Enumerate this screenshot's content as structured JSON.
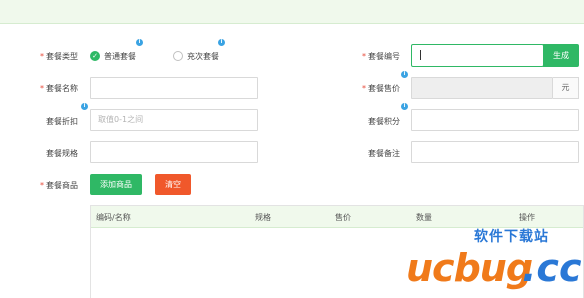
{
  "form": {
    "type_label": "套餐类型",
    "type_options": [
      "普通套餐",
      "充次套餐"
    ],
    "name_label": "套餐名称",
    "discount_label": "套餐折扣",
    "discount_placeholder": "取值0-1之间",
    "spec_label": "套餐规格",
    "goods_label": "套餐商品",
    "code_label": "套餐编号",
    "generate_label": "生成",
    "price_label": "套餐售价",
    "unit_label": "元",
    "points_label": "套餐积分",
    "remark_label": "套餐备注",
    "required_mark": "*",
    "info_glyph": "i"
  },
  "buttons": {
    "add_goods": "添加商品",
    "clear": "清空"
  },
  "table": {
    "columns": [
      "编码/名称",
      "规格",
      "售价",
      "数量",
      "操作"
    ]
  },
  "watermark": {
    "brand": "ucbug",
    "tld": ".cc",
    "slogan": "软件下载站"
  },
  "colors": {
    "primary_green": "#2fb865",
    "danger_orange": "#f0582b",
    "required_red": "#e74c3c",
    "info_blue": "#3aa3e3",
    "banner_bg": "#f0f9ec"
  }
}
